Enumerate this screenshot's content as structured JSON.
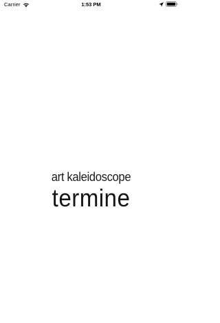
{
  "status_bar": {
    "carrier": "Carrier",
    "time": "1:53 PM",
    "icons": [
      "wifi-icon",
      "location-icon",
      "battery-icon"
    ]
  },
  "splash": {
    "subtitle": "art kaleidoscope",
    "title": "termine"
  },
  "colors": {
    "background": "#ffffff",
    "text": "#1a1a1a"
  }
}
